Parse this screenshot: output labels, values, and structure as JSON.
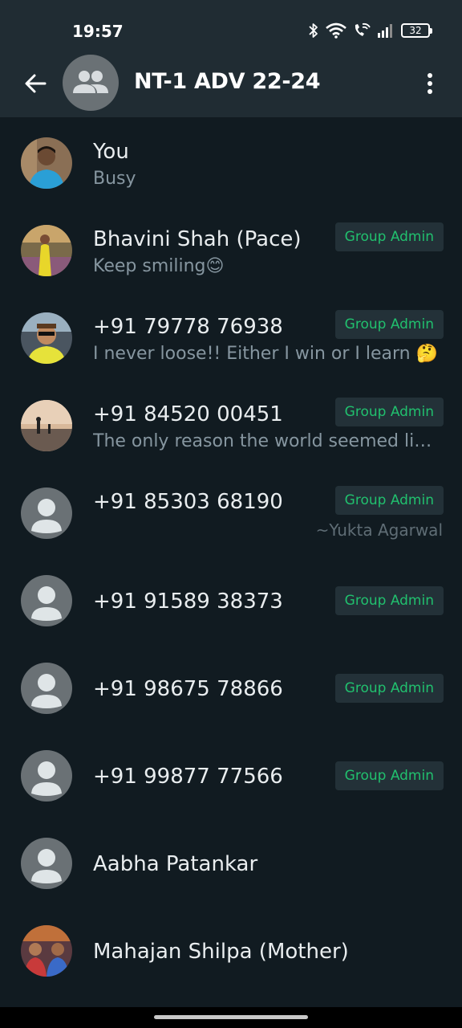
{
  "status_bar": {
    "time": "19:57",
    "battery": "32",
    "icons": [
      "bluetooth-icon",
      "wifi-icon",
      "wifi-calling-icon",
      "signal-icon",
      "battery-icon"
    ]
  },
  "header": {
    "title": "NT-1 ADV 22-24",
    "back_icon": "arrow-left-icon",
    "avatar_icon": "group-icon",
    "menu_icon": "more-vert-icon",
    "background": "#202c33"
  },
  "colors": {
    "background": "#111b21",
    "admin_badge_text": "#21c06e",
    "admin_badge_bg": "#233138",
    "secondary_text": "#8696a0"
  },
  "participants": [
    {
      "name": "You",
      "about": "Busy",
      "badge": "",
      "pushname": "",
      "avatar": "photo"
    },
    {
      "name": "Bhavini Shah (Pace)",
      "about": "Keep smiling😊",
      "badge": "Group Admin",
      "pushname": "",
      "avatar": "photo"
    },
    {
      "name": "+91 79778 76938",
      "about": "I never loose!! Either I win or I learn 🤔",
      "badge": "Group Admin",
      "pushname": "",
      "avatar": "photo"
    },
    {
      "name": "+91 84520 00451",
      "about": "The only reason the world seemed lik…",
      "badge": "Group Admin",
      "pushname": "",
      "avatar": "photo"
    },
    {
      "name": "+91 85303 68190",
      "about": "",
      "badge": "Group Admin",
      "pushname": "~Yukta Agarwal",
      "avatar": "default"
    },
    {
      "name": "+91 91589 38373",
      "about": "",
      "badge": "Group Admin",
      "pushname": "",
      "avatar": "default"
    },
    {
      "name": "+91 98675 78866",
      "about": "",
      "badge": "Group Admin",
      "pushname": "",
      "avatar": "default"
    },
    {
      "name": "+91 99877 77566",
      "about": "",
      "badge": "Group Admin",
      "pushname": "",
      "avatar": "default"
    },
    {
      "name": "Aabha Patankar",
      "about": "",
      "badge": "",
      "pushname": "",
      "avatar": "default"
    },
    {
      "name": "Mahajan Shilpa (Mother)",
      "about": "",
      "badge": "",
      "pushname": "",
      "avatar": "photo"
    }
  ]
}
